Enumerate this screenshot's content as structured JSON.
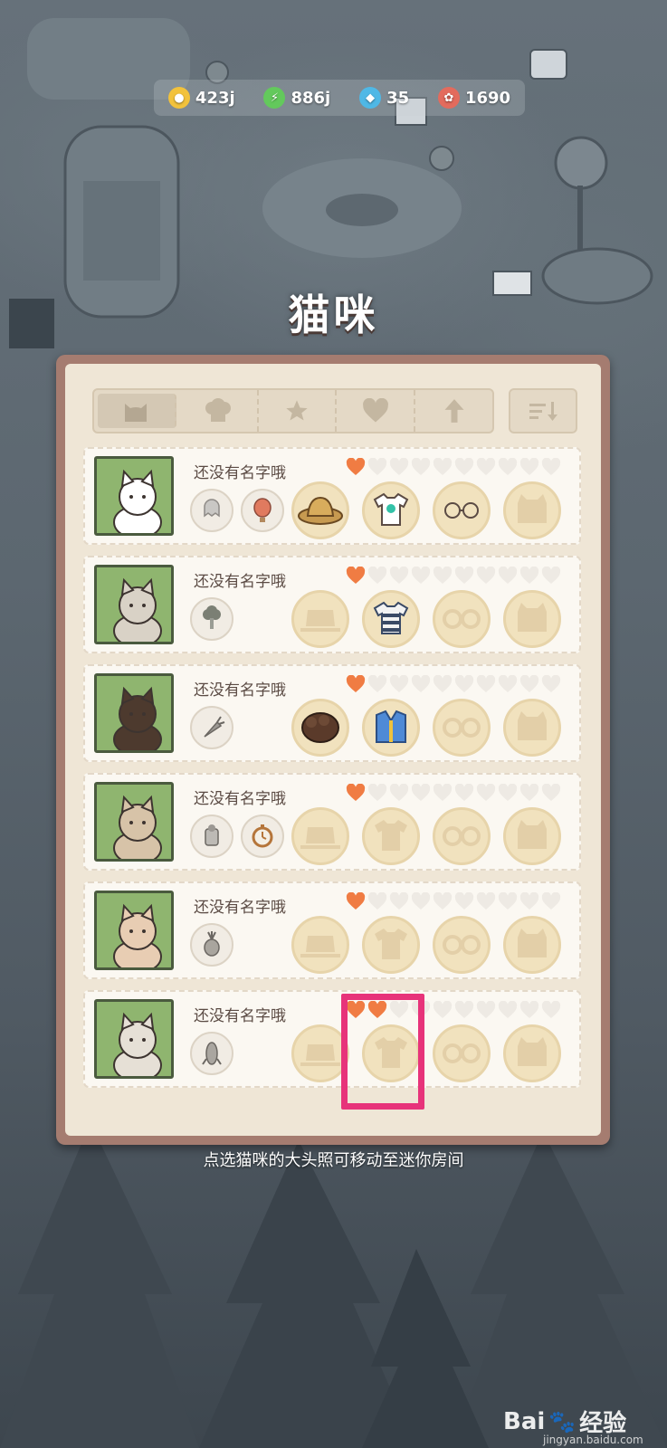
{
  "currencies": [
    {
      "icon": "gold-yarn-icon",
      "value": "423j",
      "color": "#f2c23c"
    },
    {
      "icon": "energy-bolt-icon",
      "value": "886j",
      "color": "#63c95c"
    },
    {
      "icon": "diamond-icon",
      "value": "35",
      "color": "#4fb8e6"
    },
    {
      "icon": "biscuit-icon",
      "value": "1690",
      "color": "#e36b5d"
    }
  ],
  "page_title": "猫咪",
  "tabs": [
    {
      "icon": "cat-icon",
      "active": true
    },
    {
      "icon": "chef-hat-icon",
      "active": false
    },
    {
      "icon": "star-icon",
      "active": false
    },
    {
      "icon": "heart-icon",
      "active": false
    },
    {
      "icon": "arrow-up-icon",
      "active": false
    }
  ],
  "sort_icon": "sort-icon",
  "cats": [
    {
      "name": "还没有名字哦",
      "hearts_filled": 1,
      "hearts_total": 10,
      "items": [
        "ghost-icon",
        "balloon-icon"
      ],
      "equip": {
        "hat": "straw-hat",
        "clothes": "tee-shirt",
        "glasses": "round-glasses",
        "extra": "empty"
      }
    },
    {
      "name": "还没有名字哦",
      "hearts_filled": 1,
      "hearts_total": 10,
      "items": [
        "broccoli-icon"
      ],
      "equip": {
        "hat": "empty",
        "clothes": "striped-shirt",
        "glasses": "empty",
        "extra": "empty"
      }
    },
    {
      "name": "还没有名字哦",
      "hearts_filled": 1,
      "hearts_total": 10,
      "items": [
        "carrot-icon"
      ],
      "equip": {
        "hat": "curly-wig",
        "clothes": "denim-vest",
        "glasses": "empty",
        "extra": "empty"
      }
    },
    {
      "name": "还没有名字哦",
      "hearts_filled": 1,
      "hearts_total": 10,
      "items": [
        "tool-icon",
        "stopwatch-icon"
      ],
      "equip": {
        "hat": "empty",
        "clothes": "empty",
        "glasses": "empty",
        "extra": "empty"
      }
    },
    {
      "name": "还没有名字哦",
      "hearts_filled": 1,
      "hearts_total": 10,
      "items": [
        "pineapple-icon"
      ],
      "equip": {
        "hat": "empty",
        "clothes": "empty",
        "glasses": "empty",
        "extra": "empty"
      }
    },
    {
      "name": "还没有名字哦",
      "hearts_filled": 2,
      "hearts_total": 10,
      "items": [
        "corn-icon"
      ],
      "equip": {
        "hat": "empty",
        "clothes": "empty",
        "glasses": "empty",
        "extra": "empty"
      }
    }
  ],
  "hint": "点选猫咪的大头照可移动至迷你房间",
  "watermark": {
    "brand": "Bai",
    "brand2": "经验",
    "sub": "jingyan.baidu.com"
  },
  "colors": {
    "panel": "#a57c70",
    "heart_filled": "#f07c43",
    "heart_empty": "#eeeae4",
    "highlight": "#e7337a"
  }
}
